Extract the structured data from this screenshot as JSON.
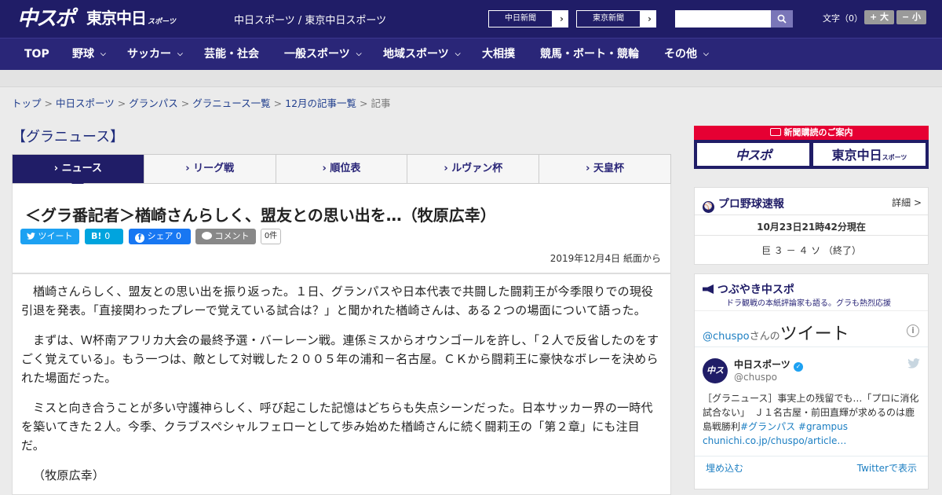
{
  "header": {
    "logo_chuspo": "中スポ",
    "logo_tokyo": "東京中日",
    "logo_tokyo_sub": "スポーツ",
    "site_name": "中日スポーツ / 東京中日スポーツ",
    "paper_links": [
      {
        "label": "中日新聞",
        "arrow": "›"
      },
      {
        "label": "東京新聞",
        "arrow": "›"
      }
    ],
    "search_placeholder": "",
    "font_size_label": "文字（0）",
    "font_larger": "+ 大",
    "font_smaller": "− 小"
  },
  "nav": {
    "items": [
      {
        "label": "TOP",
        "has_dropdown": false
      },
      {
        "label": "野球",
        "has_dropdown": true
      },
      {
        "label": "サッカー",
        "has_dropdown": true
      },
      {
        "label": "芸能・社会",
        "has_dropdown": false
      },
      {
        "label": "一般スポーツ",
        "has_dropdown": true
      },
      {
        "label": "地域スポーツ",
        "has_dropdown": true
      },
      {
        "label": "大相撲",
        "has_dropdown": false
      },
      {
        "label": "競馬・ボート・競輪",
        "has_dropdown": false
      },
      {
        "label": "その他",
        "has_dropdown": true
      }
    ]
  },
  "breadcrumb": {
    "items": [
      "トップ",
      "中日スポーツ",
      "グランパス",
      "グラニュース一覧",
      "12月の記事一覧"
    ],
    "current": "記事",
    "separator": ">"
  },
  "section_title": "【グラニュース】",
  "tabs": [
    {
      "label": "ニュース",
      "active": true
    },
    {
      "label": "リーグ戦",
      "active": false
    },
    {
      "label": "順位表",
      "active": false
    },
    {
      "label": "ルヴァン杯",
      "active": false
    },
    {
      "label": "天皇杯",
      "active": false
    }
  ],
  "tab_marker": "›",
  "article": {
    "headline": "＜グラ番記者＞楢崎さんらしく、盟友との思い出を…（牧原広幸）",
    "share": {
      "tweet": "ツイート",
      "hatena_count": "0",
      "hatena_label": "B!",
      "facebook": "シェア 0",
      "comment": "コメント",
      "comment_count": "0件"
    },
    "dateline": "2019年12月4日 紙面から",
    "paragraphs": [
      "楢崎さんらしく、盟友との思い出を振り返った。１日、グランパスや日本代表で共闘した闘莉王が今季限りでの現役引退を発表。「直接関わったプレーで覚えている試合は？」と聞かれた楢崎さんは、ある２つの場面について語った。",
      "まずは、Ｗ杯南アフリカ大会の最終予選・バーレーン戦。連係ミスからオウンゴールを許し、「２人で反省したのをすごく覚えている」。もう一つは、敵として対戦した２００５年の浦和－名古屋。ＣＫから闘莉王に豪快なボレーを決められた場面だった。",
      "ミスと向き合うことが多い守護神らしく、呼び起こした記憶はどちらも失点シーンだった。日本サッカー界の一時代を築いてきた２人。今季、クラブスペシャルフェローとして歩み始めた楢崎さんに続く闘莉王の「第２章」にも注目だ。",
      "（牧原広幸）"
    ]
  },
  "sidebar": {
    "subscription": {
      "header": "新聞購読のご案内",
      "chuspo": "中スポ",
      "tokyo": "東京中日",
      "tokyo_sub": "スポーツ"
    },
    "baseball": {
      "title": "プロ野球速報",
      "detail": "詳細 >",
      "timestamp": "10月23日21時42分現在",
      "score": "巨 ３ － ４ ソ （終了）"
    },
    "tweets": {
      "title": "つぶやき中スポ",
      "subtitle": "ドラ観戦の本紙評論家も語る。グラも熱烈応援",
      "handle": "@chuspo",
      "handle_suffix": "さんの",
      "tweets_label": "ツイート",
      "account_name": "中日スポーツ",
      "account_handle": "@chuspo",
      "avatar_text": "中スポ",
      "tweet_text": "［グラニュース］事実上の残留でも…「プロに消化試合ない」　Ｊ１名古屋・前田直輝が求めるのは鹿島戦勝利",
      "hashtags": "#グランパス #grampus",
      "link": "chunichi.co.jp/chuspo/article…",
      "embed": "埋め込む",
      "view_on_twitter": "Twitterで表示"
    }
  },
  "colors": {
    "header_bg": "#201d67",
    "nav_bg": "#2a2678",
    "accent_red": "#e60033",
    "twitter_blue": "#1da1f2",
    "hatena_blue": "#00a4de",
    "facebook_blue": "#1877f2",
    "comment_gray": "#888888"
  }
}
